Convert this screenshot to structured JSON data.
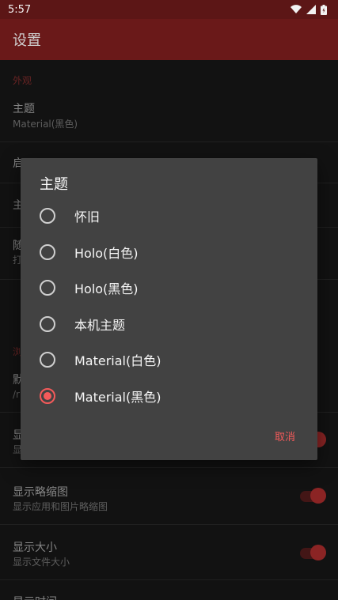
{
  "status_bar": {
    "time": "5:57"
  },
  "app_bar": {
    "title": "设置"
  },
  "settings": {
    "section_appearance": "外观",
    "theme_title": "主题",
    "theme_summary": "Material(黑色)",
    "partial_1": "启",
    "partial_2": "主",
    "partial_3_title": "随",
    "partial_3_summary": "打",
    "section_browse": "浏",
    "partial_4_title": "默",
    "partial_4_summary": "/r",
    "partial_5_title": "显",
    "partial_5_summary": "显",
    "thumbnails_title": "显示略缩图",
    "thumbnails_summary": "显示应用和图片略缩图",
    "size_title": "显示大小",
    "size_summary": "显示文件大小",
    "time_title": "显示时间"
  },
  "dialog": {
    "title": "主题",
    "options": [
      {
        "label": "怀旧",
        "checked": false
      },
      {
        "label": "Holo(白色)",
        "checked": false
      },
      {
        "label": "Holo(黑色)",
        "checked": false
      },
      {
        "label": "本机主题",
        "checked": false
      },
      {
        "label": "Material(白色)",
        "checked": false
      },
      {
        "label": "Material(黑色)",
        "checked": true
      }
    ],
    "cancel_label": "取消"
  },
  "colors": {
    "accent": "#f45a5a",
    "app_bar": "#6a1919",
    "dialog_bg": "#424242"
  }
}
